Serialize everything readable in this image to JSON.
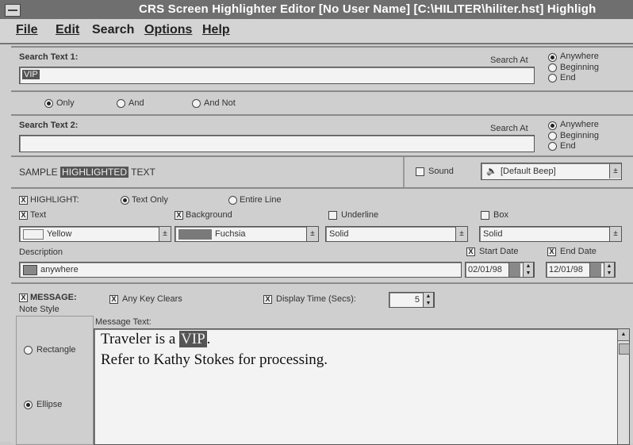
{
  "window": {
    "title": "CRS Screen Highlighter Editor [No User Name] [C:\\HILITER\\hiliter.hst] Highligh"
  },
  "menu": {
    "items": [
      {
        "label": "File"
      },
      {
        "label": "Edit"
      },
      {
        "label": "Search"
      },
      {
        "label": "Options"
      },
      {
        "label": "Help"
      }
    ]
  },
  "search1": {
    "label": "Search Text 1:",
    "value": "VIP",
    "search_at_label": "Search At",
    "options": [
      "Anywhere",
      "Beginning",
      "End"
    ],
    "selected": "Anywhere"
  },
  "logic": {
    "options": [
      "Only",
      "And",
      "And Not"
    ],
    "selected": "Only"
  },
  "search2": {
    "label": "Search Text 2:",
    "value": "",
    "search_at_label": "Search At",
    "options": [
      "Anywhere",
      "Beginning",
      "End"
    ],
    "selected": "Anywhere"
  },
  "sample": {
    "prefix": "SAMPLE",
    "highlighted": "HIGHLIGHTED",
    "suffix": "TEXT",
    "sound_label": "Sound",
    "sound_value": "[Default Beep]"
  },
  "highlight": {
    "label": "HIGHLIGHT:",
    "mode_options": [
      "Text Only",
      "Entire Line"
    ],
    "mode_selected": "Text Only",
    "text_label": "Text",
    "text_color": "Yellow",
    "background_label": "Background",
    "background_color": "Fuchsia",
    "underline_label": "Underline",
    "underline_value": "Solid",
    "box_label": "Box",
    "box_value": "Solid",
    "description_label": "Description",
    "description_value": "anywhere",
    "start_date_label": "Start Date",
    "start_date": "02/01/98",
    "end_date_label": "End Date",
    "end_date": "12/01/98"
  },
  "message": {
    "label": "MESSAGE:",
    "any_key_clears": "Any Key Clears",
    "display_time_label": "Display Time (Secs):",
    "display_time_value": "5",
    "note_style_label": "Note Style",
    "note_style_options": [
      "Rectangle",
      "Ellipse"
    ],
    "note_style_selected": "Ellipse",
    "message_text_label": "Message Text:",
    "line1_prefix": "Traveler is a",
    "line1_highlight": "VIP",
    "line1_suffix": ".",
    "line2": "Refer to Kathy Stokes for processing."
  }
}
